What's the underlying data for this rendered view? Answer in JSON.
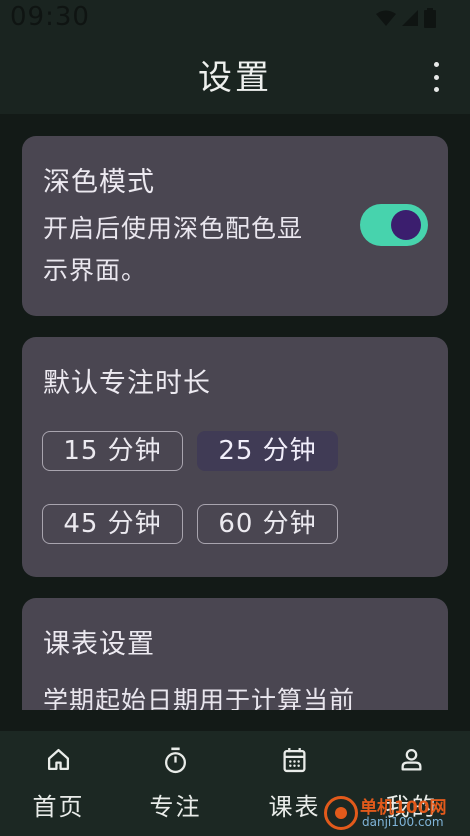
{
  "status_bar": {
    "time": "09:30"
  },
  "app_bar": {
    "title": "设置"
  },
  "dark_mode": {
    "title": "深色模式",
    "desc_line1": "开启后使用深色配色显",
    "desc_line2": "示界面。",
    "enabled": true
  },
  "focus_duration": {
    "title": "默认专注时长",
    "options": [
      "15 分钟",
      "25 分钟",
      "45 分钟",
      "60 分钟"
    ],
    "selected": "25 分钟"
  },
  "schedule": {
    "title": "课表设置",
    "desc_partial": "学期起始日期用于计算当前"
  },
  "bottom_nav": {
    "items": [
      {
        "label": "首页",
        "icon": "home-icon"
      },
      {
        "label": "专注",
        "icon": "timer-icon"
      },
      {
        "label": "课表",
        "icon": "calendar-icon"
      },
      {
        "label": "我的",
        "icon": "person-icon"
      }
    ]
  },
  "watermark": {
    "text": "单机100网",
    "url": "danji100.com"
  },
  "colors": {
    "accent": "#47d3ad",
    "card": "#4a4651",
    "background": "#131a17",
    "watermark": "#e25a1b"
  }
}
